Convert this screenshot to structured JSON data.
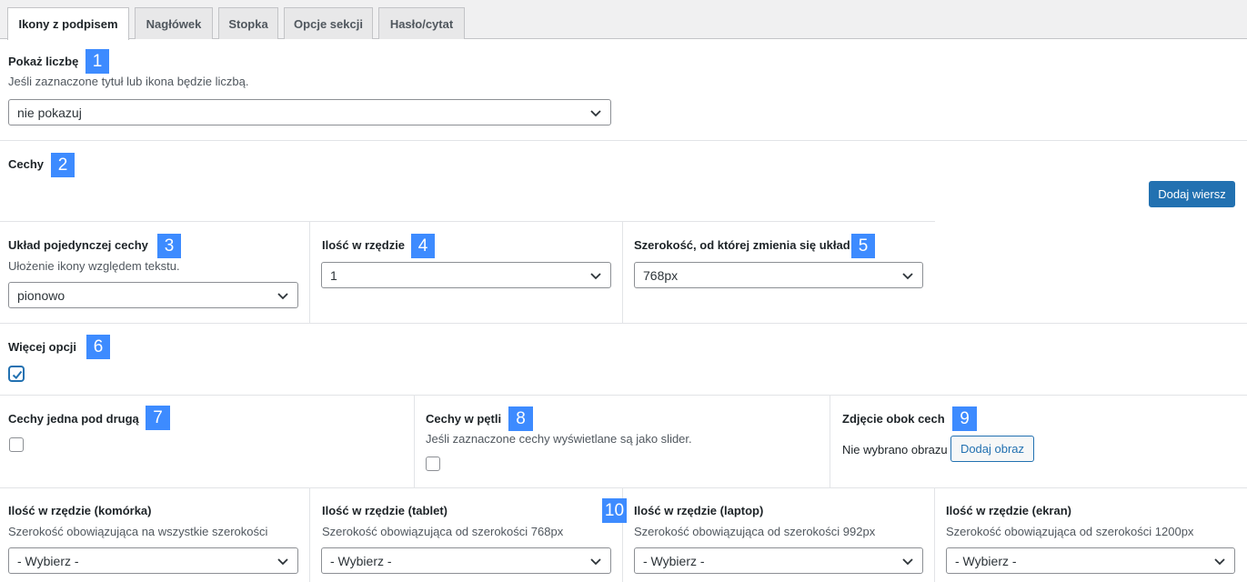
{
  "tabs": [
    {
      "label": "Ikony z podpisem",
      "active": true
    },
    {
      "label": "Nagłówek",
      "active": false
    },
    {
      "label": "Stopka",
      "active": false
    },
    {
      "label": "Opcje sekcji",
      "active": false
    },
    {
      "label": "Hasło/cytat",
      "active": false
    }
  ],
  "show_number": {
    "label": "Pokaż liczbę",
    "badge": "1",
    "description": "Jeśli zaznaczone tytuł lub ikona będzie liczbą.",
    "value": "nie pokazuj"
  },
  "features": {
    "label": "Cechy",
    "badge": "2",
    "add_row_button": "Dodaj wiersz"
  },
  "single_layout": {
    "label": "Układ pojedynczej cechy",
    "badge": "3",
    "description": "Ułożenie ikony względem tekstu.",
    "value": "pionowo"
  },
  "per_row": {
    "label": "Ilość w rzędzie",
    "badge": "4",
    "value": "1"
  },
  "layout_width": {
    "label": "Szerokość, od której zmienia się układ",
    "badge": "5",
    "value": "768px"
  },
  "more_options": {
    "label": "Więcej opcji",
    "badge": "6",
    "checked": true
  },
  "stacked": {
    "label": "Cechy jedna pod drugą",
    "badge": "7",
    "checked": false
  },
  "loop": {
    "label": "Cechy w pętli",
    "badge": "8",
    "description": "Jeśli zaznaczone cechy wyświetlane są jako slider.",
    "checked": false
  },
  "image": {
    "label": "Zdjęcie obok cech",
    "badge": "9",
    "no_image_text": "Nie wybrano obrazu",
    "add_image_button": "Dodaj obraz"
  },
  "responsive": {
    "badge": "10",
    "mobile": {
      "label": "Ilość w rzędzie (komórka)",
      "description": "Szerokość obowiązująca na wszystkie szerokości",
      "value": "- Wybierz -"
    },
    "tablet": {
      "label": "Ilość w rzędzie (tablet)",
      "description": "Szerokość obowiązująca od szerokości 768px",
      "value": "- Wybierz -"
    },
    "laptop": {
      "label": "Ilość w rzędzie (laptop)",
      "description": "Szerokość obowiązująca od szerokości 992px",
      "value": "- Wybierz -"
    },
    "screen": {
      "label": "Ilość w rzędzie (ekran)",
      "description": "Szerokość obowiązująca od szerokości 1200px",
      "value": "- Wybierz -"
    }
  },
  "colors": {
    "primary": "#2271b1",
    "badge": "#3d8bff"
  }
}
